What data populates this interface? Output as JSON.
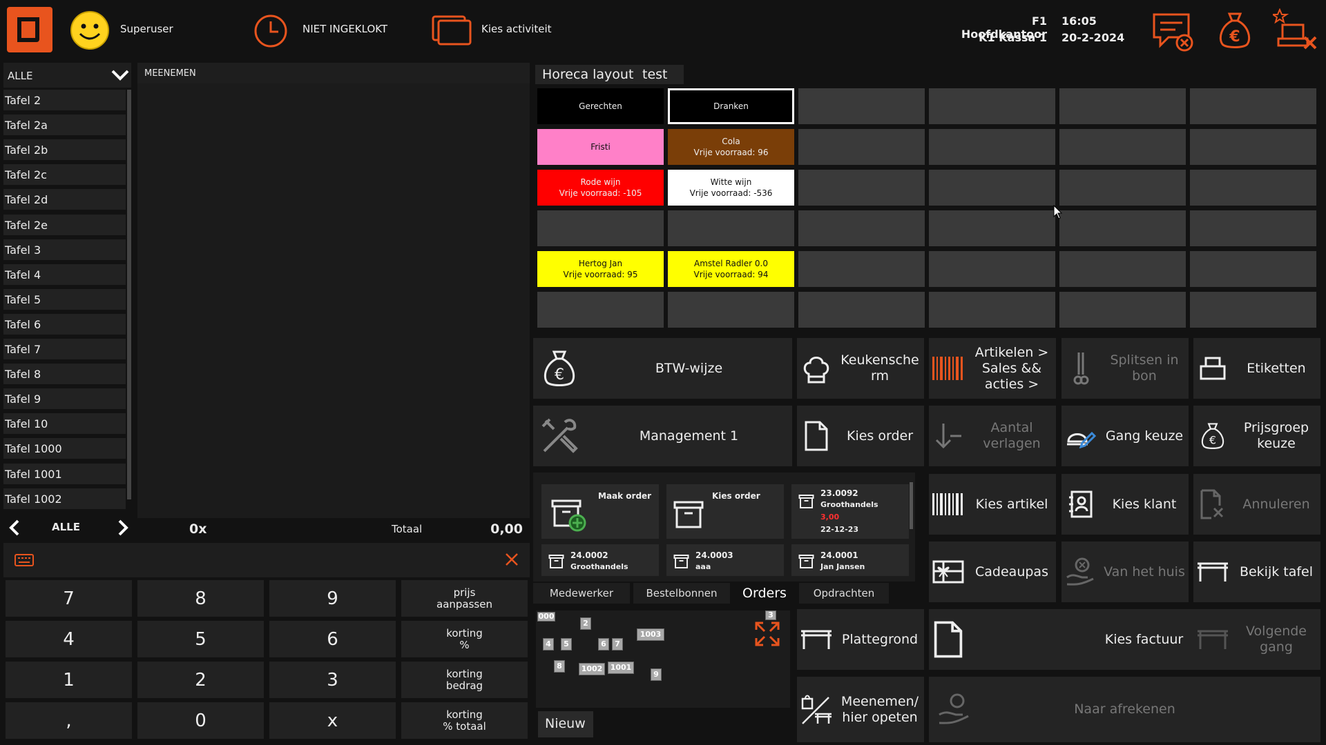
{
  "header": {
    "user_name": "Superuser",
    "clock_status": "NIET INGEKLOKT",
    "activity": "Kies activiteit",
    "location": "F1 Hoofdkantoor",
    "register": "K1 Kassa 1",
    "time": "16:05",
    "date": "20-2-2024",
    "accent_color": "#e8541e"
  },
  "table_list": {
    "filter": "ALLE",
    "items": [
      "Tafel 2",
      "Tafel 2a",
      "Tafel 2b",
      "Tafel 2c",
      "Tafel 2d",
      "Tafel 2e",
      "Tafel 3",
      "Tafel 4",
      "Tafel 5",
      "Tafel 6",
      "Tafel 7",
      "Tafel 8",
      "Tafel 9",
      "Tafel 10",
      "Tafel 1000",
      "Tafel 1001",
      "Tafel 1002"
    ],
    "footer_label": "ALLE"
  },
  "order": {
    "title": "MEENEMEN",
    "count": "0x",
    "total_label": "Totaal",
    "total_value": "0,00"
  },
  "numpad": {
    "keys": [
      "7",
      "8",
      "9",
      "4",
      "5",
      "6",
      "1",
      "2",
      "3",
      ",",
      "0",
      "x"
    ],
    "functions": [
      {
        "line1": "prijs",
        "line2": "aanpassen"
      },
      {
        "line1": "korting",
        "line2": "%"
      },
      {
        "line1": "korting",
        "line2": "bedrag"
      },
      {
        "line1": "korting",
        "line2": "% totaal"
      }
    ]
  },
  "layout": {
    "tabs": [
      "Horeca layout",
      "test"
    ],
    "categories": [
      "Gerechten",
      "Dranken"
    ],
    "products": [
      {
        "name": "Fristi",
        "stock": "",
        "bg": "#ff80c8",
        "fg": "#111"
      },
      {
        "name": "Cola",
        "stock": "Vrije voorraad:  96",
        "bg": "#7a3e08",
        "fg": "#eee"
      },
      {
        "name": "Rode wijn",
        "stock": "Vrije voorraad:  -105",
        "bg": "#ff0000",
        "fg": "#eee"
      },
      {
        "name": "Witte wijn",
        "stock": "Vrije voorraad:  -536",
        "bg": "#ffffff",
        "fg": "#111"
      },
      {
        "name": "Hertog Jan",
        "stock": "Vrije voorraad:  95",
        "bg": "#ffff00",
        "fg": "#111"
      },
      {
        "name": "Amstel Radler 0.0",
        "stock": "Vrije voorraad:  94",
        "bg": "#ffff00",
        "fg": "#111"
      }
    ]
  },
  "actions": {
    "btw": "BTW-wijze",
    "keuken": "Keukensche rm",
    "artikelen_sales": "Artikelen > Sales && acties >",
    "splitsen": "Splitsen in bon",
    "etiketten": "Etiketten",
    "management": "Management 1",
    "kies_order": "Kies order",
    "aantal_verlagen": "Aantal verlagen",
    "gang_keuze": "Gang keuze",
    "prijsgroep": "Prijsgroep keuze",
    "kies_artikel": "Kies artikel",
    "kies_klant": "Kies klant",
    "annuleren": "Annuleren",
    "cadeaupas": "Cadeaupas",
    "van_het_huis": "Van het huis",
    "bekijk_tafel": "Bekijk tafel",
    "plattegrond": "Plattegrond",
    "kies_factuur": "Kies factuur",
    "volgende_gang": "Volgende gang",
    "meenemen": "Meenemen/ hier opeten",
    "afrekenen": "Naar afrekenen"
  },
  "orders_panel": {
    "maak_order": "Maak order",
    "kies_order": "Kies order",
    "cards": [
      {
        "number": "23.0092",
        "name": "Groothandels",
        "amount": "3,00",
        "date": "22-12-23"
      },
      {
        "number": "24.0002",
        "name": "Groothandels"
      },
      {
        "number": "24.0003",
        "name": "aaa"
      },
      {
        "number": "24.0001",
        "name": "Jan Jansen"
      }
    ],
    "tabs": [
      "Medewerker",
      "Bestelbonnen",
      "Orders",
      "Opdrachten"
    ],
    "map_tables": [
      "000",
      "2",
      "1003",
      "4",
      "5",
      "6",
      "7",
      "8",
      "1002",
      "1001",
      "9",
      "3"
    ],
    "new_label": "Nieuw"
  }
}
